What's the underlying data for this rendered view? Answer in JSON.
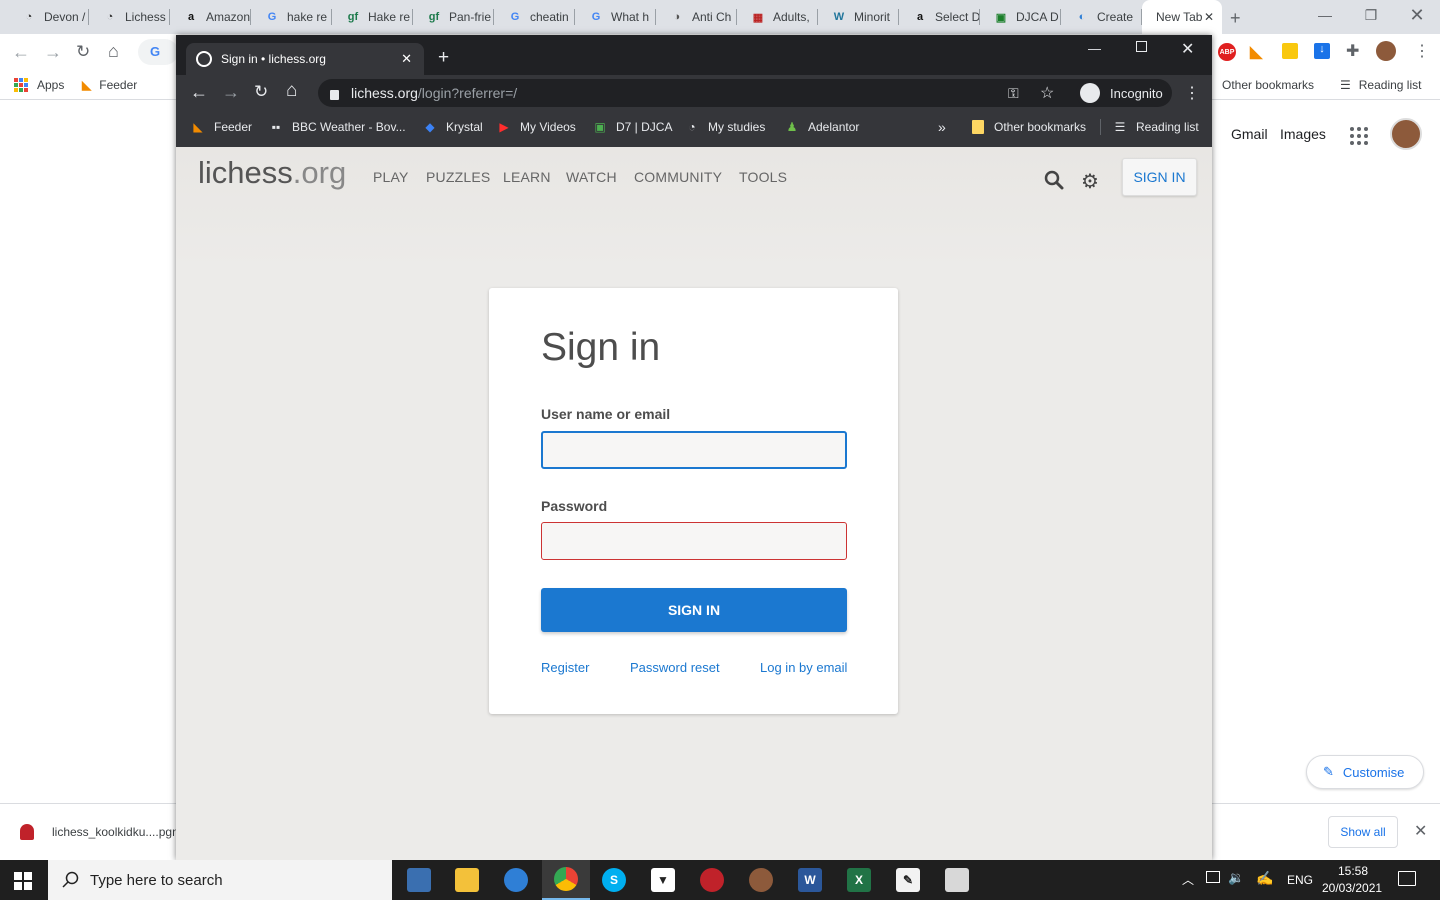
{
  "background_window": {
    "tabs": [
      {
        "title": "Devon /",
        "icon": "lichess-icon"
      },
      {
        "title": "Lichess",
        "icon": "lichess-icon"
      },
      {
        "title": "Amazon",
        "icon": "amazon-icon"
      },
      {
        "title": "hake re",
        "icon": "google-icon"
      },
      {
        "title": "Hake re",
        "icon": "gf-icon"
      },
      {
        "title": "Pan-frie",
        "icon": "gf-icon"
      },
      {
        "title": "cheatin",
        "icon": "google-icon"
      },
      {
        "title": "What h",
        "icon": "google-icon"
      },
      {
        "title": "Anti Ch",
        "icon": "globe-icon"
      },
      {
        "title": "Adults,",
        "icon": "chessboard-icon"
      },
      {
        "title": "Minorit",
        "icon": "wordpress-icon"
      },
      {
        "title": "Select D",
        "icon": "amazon-icon"
      },
      {
        "title": "DJCA D",
        "icon": "djca-icon"
      },
      {
        "title": "Create",
        "icon": "edge-icon"
      },
      {
        "title": "New Tab",
        "icon": "none"
      }
    ],
    "bookmarks": [
      {
        "label": "Apps"
      },
      {
        "label": "Feeder"
      }
    ],
    "right_bookmarks": {
      "other": "Other bookmarks",
      "reading": "Reading list"
    },
    "google_links": {
      "gmail": "Gmail",
      "images": "Images"
    },
    "customise_label": "Customise",
    "download": {
      "filename": "lichess_koolkidku....pgn",
      "show_all": "Show all"
    }
  },
  "incognito_window": {
    "tab_title": "Sign in • lichess.org",
    "url_host": "lichess.org",
    "url_path": "/login?referrer=/",
    "profile_label": "Incognito",
    "bookmarks": [
      {
        "label": "Feeder",
        "icon": "rss-icon"
      },
      {
        "label": "BBC Weather - Bov...",
        "icon": "bbc-icon"
      },
      {
        "label": "Krystal",
        "icon": "diamond-icon"
      },
      {
        "label": "My Videos",
        "icon": "youtube-icon"
      },
      {
        "label": "D7 | DJCA",
        "icon": "djca-icon"
      },
      {
        "label": "My studies",
        "icon": "lichess-icon"
      },
      {
        "label": "Adelantor",
        "icon": "chess-pawn-icon"
      }
    ],
    "overflow_label": "»",
    "other_bookmarks": "Other bookmarks",
    "reading_list": "Reading list"
  },
  "lichess": {
    "logo_main": "lichess",
    "logo_tld": ".org",
    "nav": [
      "PLAY",
      "PUZZLES",
      "LEARN",
      "WATCH",
      "COMMUNITY",
      "TOOLS"
    ],
    "signin_top": "SIGN IN",
    "form": {
      "title": "Sign in",
      "username_label": "User name or email",
      "username_value": "",
      "password_label": "Password",
      "password_value": "",
      "submit": "SIGN IN",
      "links": [
        "Register",
        "Password reset",
        "Log in by email"
      ]
    }
  },
  "taskbar": {
    "search_placeholder": "Type here to search",
    "language": "ENG",
    "time": "15:58",
    "date": "20/03/2021"
  },
  "colors": {
    "lichess_blue": "#1b78d0",
    "error_red": "#cc3333",
    "incognito_dark": "#202124",
    "incognito_toolbar": "#35363a"
  }
}
